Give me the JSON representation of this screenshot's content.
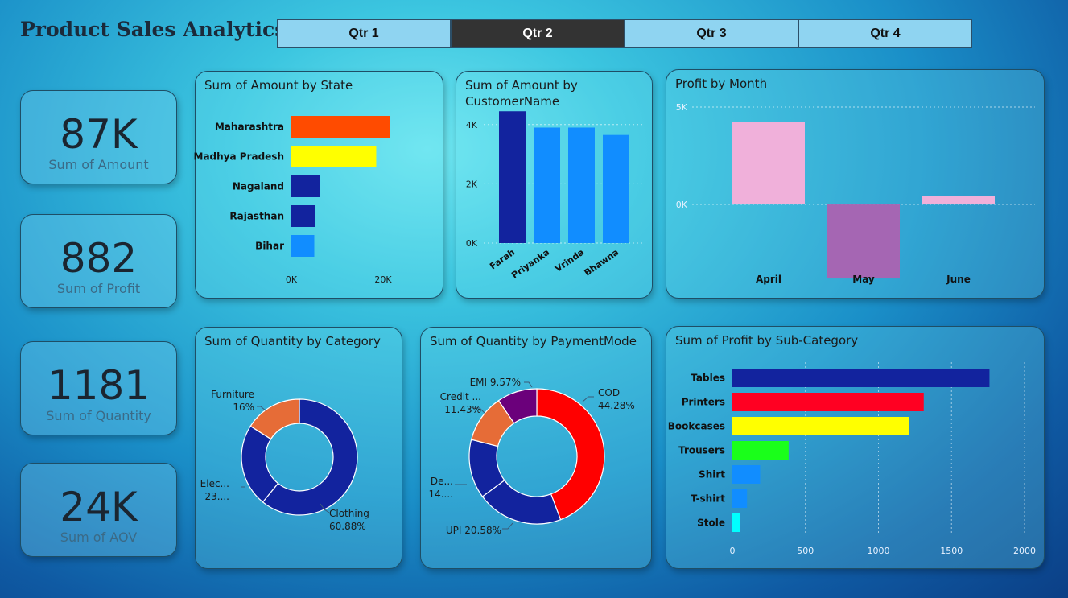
{
  "header": {
    "title": "Product Sales Analytics"
  },
  "tabs": [
    {
      "label": "Qtr 1",
      "active": false
    },
    {
      "label": "Qtr 2",
      "active": true
    },
    {
      "label": "Qtr 3",
      "active": false
    },
    {
      "label": "Qtr 4",
      "active": false
    }
  ],
  "kpis": [
    {
      "value": "87K",
      "label": "Sum of Amount"
    },
    {
      "value": "882",
      "label": "Sum of Profit"
    },
    {
      "value": "1181",
      "label": "Sum of Quantity"
    },
    {
      "value": "24K",
      "label": "Sum of AOV"
    }
  ],
  "chart_data": [
    {
      "id": "amount_by_state",
      "type": "bar",
      "orientation": "horizontal",
      "title": "Sum of Amount by State",
      "categories": [
        "Maharashtra",
        "Madhya Pradesh",
        "Nagaland",
        "Rajasthan",
        "Bihar"
      ],
      "values": [
        21500,
        18500,
        6200,
        5200,
        5000
      ],
      "colors": [
        "#ff4b00",
        "#ffff00",
        "#12239e",
        "#12239e",
        "#118dff"
      ],
      "xlim": [
        0,
        30000
      ],
      "xticks": [
        "0K",
        "20K"
      ],
      "xtick_values": [
        0,
        20000
      ],
      "grid": false
    },
    {
      "id": "amount_by_customer",
      "type": "bar",
      "title": "Sum of Amount by CustomerName",
      "title_lines": [
        "Sum of Amount by",
        "CustomerName"
      ],
      "categories": [
        "Farah",
        "Priyanka",
        "Vrinda",
        "Bhawna"
      ],
      "values": [
        4450,
        3900,
        3900,
        3650
      ],
      "colors": [
        "#12239e",
        "#118dff",
        "#118dff",
        "#118dff"
      ],
      "ylim": [
        0,
        5000
      ],
      "yticks": [
        "0K",
        "2K",
        "4K"
      ],
      "ytick_values": [
        0,
        2000,
        4000
      ],
      "grid": true
    },
    {
      "id": "profit_by_month",
      "type": "bar",
      "title": "Profit by Month",
      "categories": [
        "April",
        "May",
        "June"
      ],
      "values": [
        4250,
        -3800,
        450
      ],
      "colors": [
        "#f0b0da",
        "#a566b3",
        "#f0b0da"
      ],
      "ylim": [
        -4500,
        5000
      ],
      "yticks": [
        "0K",
        "5K"
      ],
      "ytick_values": [
        0,
        5000
      ],
      "grid": true
    },
    {
      "id": "quantity_by_category",
      "type": "pie",
      "donut": true,
      "title": "Sum of Quantity by Category",
      "categories": [
        "Clothing",
        "Electronics",
        "Furniture"
      ],
      "labels": [
        "Clothing\n60.88%",
        "Elec...\n23....",
        "Furniture\n16%"
      ],
      "values": [
        60.88,
        23.12,
        16.0
      ],
      "colors": [
        "#12239e",
        "#12239e",
        "#e66c37"
      ]
    },
    {
      "id": "quantity_by_paymentmode",
      "type": "pie",
      "donut": true,
      "title": "Sum of Quantity by PaymentMode",
      "categories": [
        "COD",
        "UPI",
        "Debit Card",
        "Credit Card",
        "EMI"
      ],
      "labels": [
        "COD\n44.28%",
        "UPI 20.58%",
        "De...\n14....",
        "Credit ...\n11.43%",
        "EMI 9.57%"
      ],
      "values": [
        44.28,
        20.58,
        14.14,
        11.43,
        9.57
      ],
      "colors": [
        "#ff0000",
        "#12239e",
        "#12239e",
        "#e66c37",
        "#6b007b"
      ]
    },
    {
      "id": "profit_by_subcategory",
      "type": "bar",
      "orientation": "horizontal",
      "title": "Sum of Profit by Sub-Category",
      "categories": [
        "Tables",
        "Printers",
        "Bookcases",
        "Trousers",
        "Shirt",
        "T-shirt",
        "Stole"
      ],
      "values": [
        1760,
        1310,
        1210,
        385,
        190,
        100,
        55
      ],
      "colors": [
        "#12239e",
        "#ff0022",
        "#ffff00",
        "#1aff1a",
        "#118dff",
        "#118dff",
        "#00ffff"
      ],
      "xlim": [
        0,
        2000
      ],
      "xticks": [
        "0",
        "500",
        "1000",
        "1500",
        "2000"
      ],
      "xtick_values": [
        0,
        500,
        1000,
        1500,
        2000
      ],
      "grid": true
    }
  ]
}
